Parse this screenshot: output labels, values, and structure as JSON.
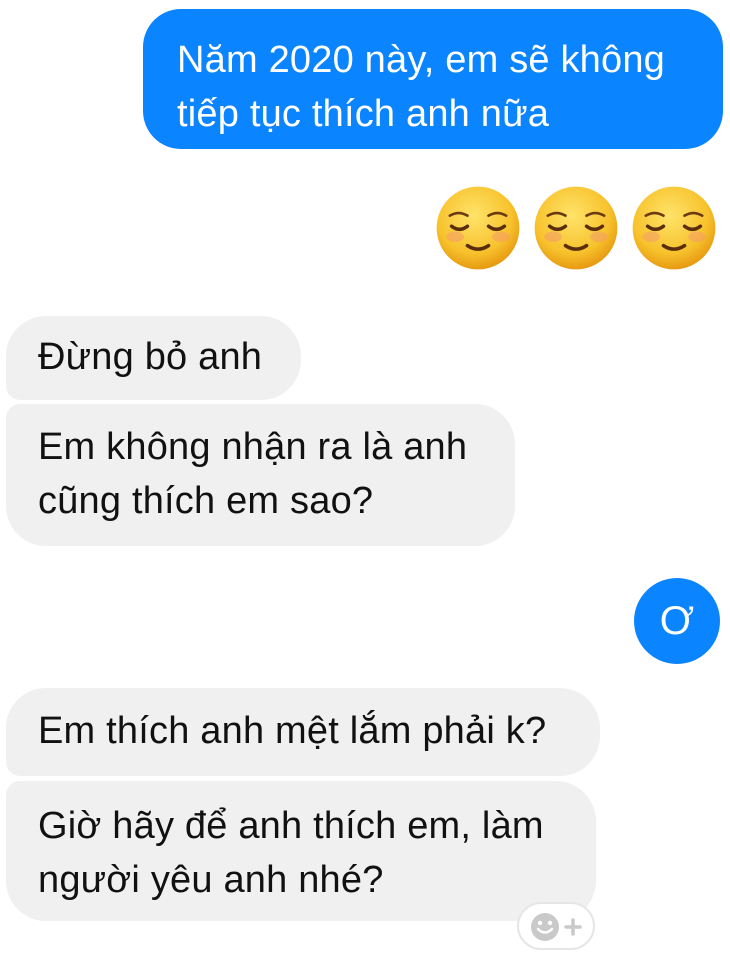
{
  "messages": [
    {
      "from": "me",
      "text": "Năm 2020 này, em sẽ không\ntiếp tục thích anh nữa"
    },
    {
      "from": "me",
      "emoji": [
        "smiling-face-icon",
        "smiling-face-icon",
        "smiling-face-icon"
      ]
    },
    {
      "from": "them",
      "text": "Đừng bỏ anh"
    },
    {
      "from": "them",
      "text": "Em không nhận ra là anh\ncũng thích em sao?"
    },
    {
      "from": "me",
      "text": "Ơ"
    },
    {
      "from": "them",
      "text": "Em thích anh mệt lắm phải k?"
    },
    {
      "from": "them",
      "text": "Giờ hãy để anh thích em, làm\nngười yêu anh nhé?"
    }
  ],
  "colors": {
    "sent_bubble": "#0b84ff",
    "received_bubble": "#f0f0f0",
    "emoji_face": "#f7c22c"
  },
  "reaction_button": {
    "icon": "add-reaction-icon"
  }
}
